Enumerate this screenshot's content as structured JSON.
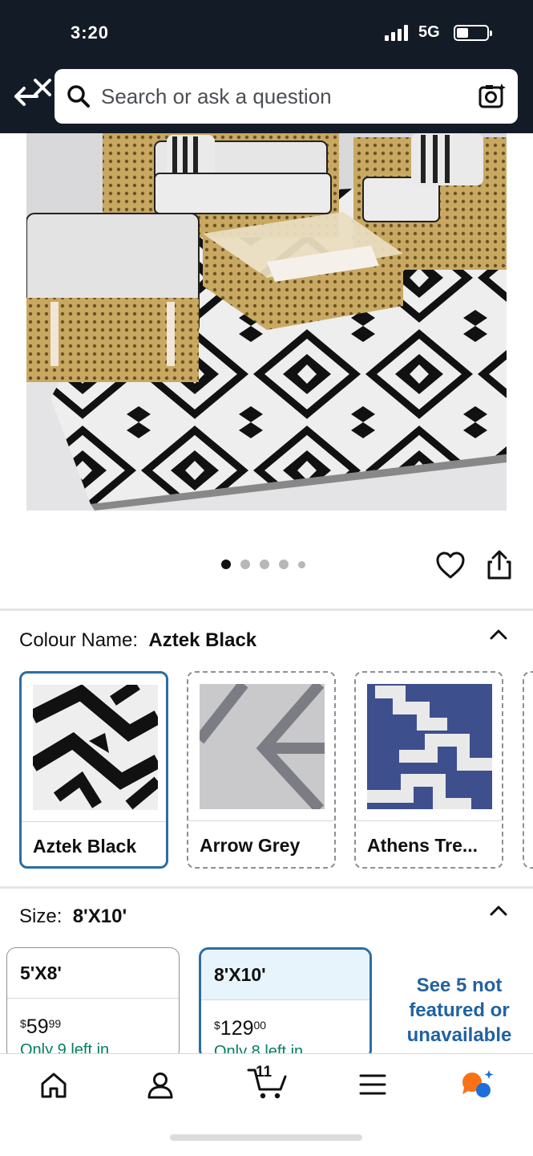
{
  "status_bar": {
    "time": "3:20",
    "network": "5G"
  },
  "search": {
    "placeholder": "Search or ask a question"
  },
  "carousel": {
    "total_images": 5,
    "active_index": 0
  },
  "colour": {
    "label": "Colour Name:",
    "selected": "Aztek Black",
    "options": [
      {
        "name": "Aztek Black",
        "selected": true
      },
      {
        "name": "Arrow Grey",
        "selected": false
      },
      {
        "name": "Athens Tre...",
        "selected": false
      }
    ]
  },
  "size": {
    "label": "Size:",
    "selected": "8'X10'",
    "options": [
      {
        "name": "5'X8'",
        "price_symbol": "$",
        "price_whole": "59",
        "price_fraction": "99",
        "stock": "Only 9 left in",
        "selected": false
      },
      {
        "name": "8'X10'",
        "price_symbol": "$",
        "price_whole": "129",
        "price_fraction": "00",
        "stock": "Only 8 left in",
        "selected": true
      }
    ],
    "see_more": "See 5 not featured or unavailable"
  },
  "bottom_nav": {
    "cart_count": "11"
  },
  "colors": {
    "header_bg": "#131b26",
    "selected_border": "#2a6ea4",
    "link": "#2162a1",
    "stock_green": "#067d62",
    "assistant_orange": "#f97316",
    "assistant_blue": "#1e6fd9"
  },
  "icons": [
    "back-close-icon",
    "search-icon",
    "camera-lens-icon",
    "heart-icon",
    "share-icon",
    "chevron-up-icon",
    "home-icon",
    "account-icon",
    "cart-icon",
    "menu-icon",
    "assistant-icon"
  ]
}
